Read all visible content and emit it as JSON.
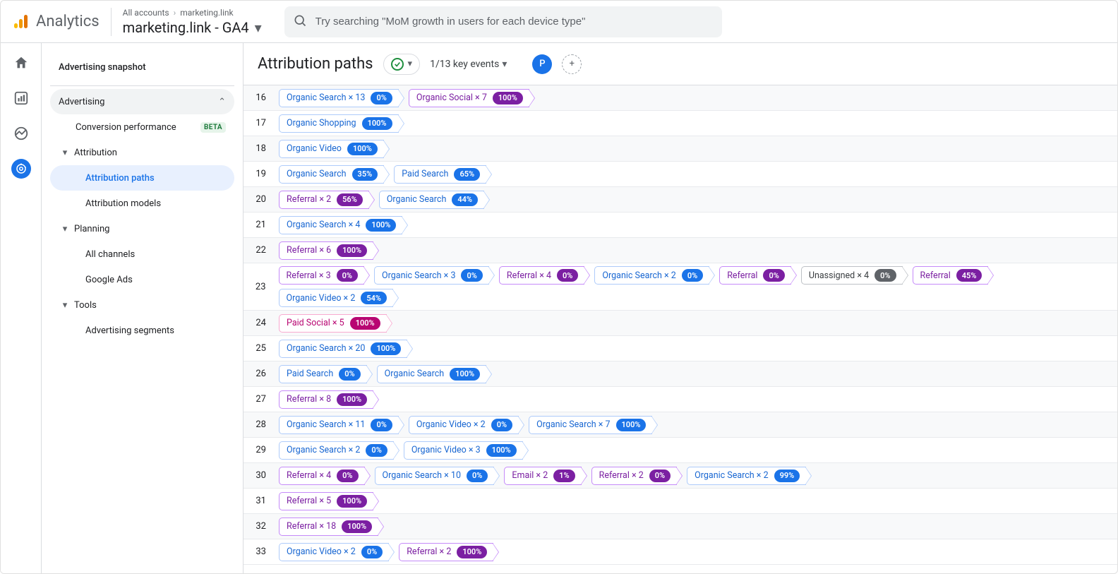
{
  "header": {
    "brand": "Analytics",
    "breadcrumb_all": "All accounts",
    "breadcrumb_prop": "marketing.link",
    "property_name": "marketing.link - GA4",
    "search_placeholder": "Try searching \"MoM growth in users for each device type\""
  },
  "sidebar": {
    "snapshot": "Advertising snapshot",
    "advertising": "Advertising",
    "conversion_perf": "Conversion performance",
    "beta": "BETA",
    "attribution": "Attribution",
    "attribution_paths": "Attribution paths",
    "attribution_models": "Attribution models",
    "planning": "Planning",
    "all_channels": "All channels",
    "google_ads": "Google Ads",
    "tools": "Tools",
    "adv_segments": "Advertising segments"
  },
  "page": {
    "title": "Attribution paths",
    "key_events": "1/13 key events",
    "avatar_letter": "P"
  },
  "rows": [
    {
      "idx": 16,
      "chips": [
        {
          "kind": "organic-search",
          "label": "Organic Search × 13",
          "pct": "0%"
        },
        {
          "kind": "organic-social",
          "label": "Organic Social × 7",
          "pct": "100%"
        }
      ]
    },
    {
      "idx": 17,
      "chips": [
        {
          "kind": "organic-shopping",
          "label": "Organic Shopping",
          "pct": "100%"
        }
      ]
    },
    {
      "idx": 18,
      "chips": [
        {
          "kind": "organic-video",
          "label": "Organic Video",
          "pct": "100%"
        }
      ]
    },
    {
      "idx": 19,
      "chips": [
        {
          "kind": "organic-search",
          "label": "Organic Search",
          "pct": "35%"
        },
        {
          "kind": "paid-search",
          "label": "Paid Search",
          "pct": "65%"
        }
      ]
    },
    {
      "idx": 20,
      "chips": [
        {
          "kind": "referral",
          "label": "Referral × 2",
          "pct": "56%"
        },
        {
          "kind": "organic-search",
          "label": "Organic Search",
          "pct": "44%"
        }
      ]
    },
    {
      "idx": 21,
      "chips": [
        {
          "kind": "organic-search",
          "label": "Organic Search × 4",
          "pct": "100%"
        }
      ]
    },
    {
      "idx": 22,
      "chips": [
        {
          "kind": "referral",
          "label": "Referral × 6",
          "pct": "100%"
        }
      ]
    },
    {
      "idx": 23,
      "chips": [
        {
          "kind": "referral",
          "label": "Referral × 3",
          "pct": "0%"
        },
        {
          "kind": "organic-search",
          "label": "Organic Search × 3",
          "pct": "0%"
        },
        {
          "kind": "referral",
          "label": "Referral × 4",
          "pct": "0%"
        },
        {
          "kind": "organic-search",
          "label": "Organic Search × 2",
          "pct": "0%"
        },
        {
          "kind": "referral",
          "label": "Referral",
          "pct": "0%"
        },
        {
          "kind": "unassigned",
          "label": "Unassigned × 4",
          "pct": "0%"
        },
        {
          "kind": "referral",
          "label": "Referral",
          "pct": "45%"
        },
        {
          "kind": "organic-video",
          "label": "Organic Video × 2",
          "pct": "54%"
        }
      ]
    },
    {
      "idx": 24,
      "chips": [
        {
          "kind": "paid-social",
          "label": "Paid Social × 5",
          "pct": "100%"
        }
      ]
    },
    {
      "idx": 25,
      "chips": [
        {
          "kind": "organic-search",
          "label": "Organic Search × 20",
          "pct": "100%"
        }
      ]
    },
    {
      "idx": 26,
      "chips": [
        {
          "kind": "paid-search",
          "label": "Paid Search",
          "pct": "0%"
        },
        {
          "kind": "organic-search",
          "label": "Organic Search",
          "pct": "100%"
        }
      ]
    },
    {
      "idx": 27,
      "chips": [
        {
          "kind": "referral",
          "label": "Referral × 8",
          "pct": "100%"
        }
      ]
    },
    {
      "idx": 28,
      "chips": [
        {
          "kind": "organic-search",
          "label": "Organic Search × 11",
          "pct": "0%"
        },
        {
          "kind": "organic-video",
          "label": "Organic Video × 2",
          "pct": "0%"
        },
        {
          "kind": "organic-search",
          "label": "Organic Search × 7",
          "pct": "100%"
        }
      ]
    },
    {
      "idx": 29,
      "chips": [
        {
          "kind": "organic-search",
          "label": "Organic Search × 2",
          "pct": "0%"
        },
        {
          "kind": "organic-video",
          "label": "Organic Video × 3",
          "pct": "100%"
        }
      ]
    },
    {
      "idx": 30,
      "chips": [
        {
          "kind": "referral",
          "label": "Referral × 4",
          "pct": "0%"
        },
        {
          "kind": "organic-search",
          "label": "Organic Search × 10",
          "pct": "0%"
        },
        {
          "kind": "email",
          "label": "Email × 2",
          "pct": "1%"
        },
        {
          "kind": "referral",
          "label": "Referral × 2",
          "pct": "0%"
        },
        {
          "kind": "organic-search",
          "label": "Organic Search × 2",
          "pct": "99%"
        }
      ]
    },
    {
      "idx": 31,
      "chips": [
        {
          "kind": "referral",
          "label": "Referral × 5",
          "pct": "100%"
        }
      ]
    },
    {
      "idx": 32,
      "chips": [
        {
          "kind": "referral",
          "label": "Referral × 18",
          "pct": "100%"
        }
      ]
    },
    {
      "idx": 33,
      "chips": [
        {
          "kind": "organic-video",
          "label": "Organic Video × 2",
          "pct": "0%"
        },
        {
          "kind": "referral",
          "label": "Referral × 2",
          "pct": "100%"
        }
      ]
    }
  ]
}
